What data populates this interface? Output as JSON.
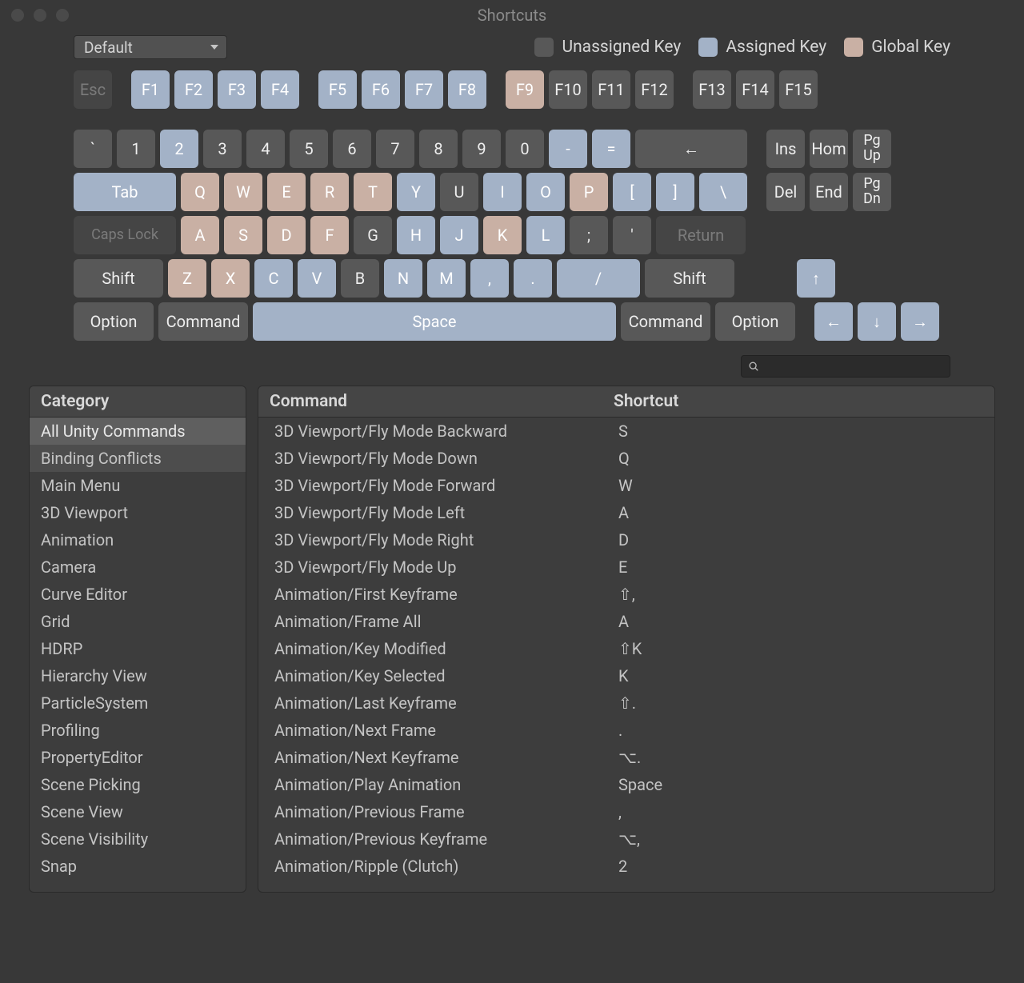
{
  "window": {
    "title": "Shortcuts"
  },
  "toolbar": {
    "profile": "Default",
    "legend": {
      "unassigned": "Unassigned Key",
      "assigned": "Assigned Key",
      "global": "Global Key"
    }
  },
  "keyboard": {
    "row_fn": [
      {
        "label": "Esc",
        "state": "disabled"
      },
      null,
      {
        "label": "F1",
        "state": "assigned"
      },
      {
        "label": "F2",
        "state": "assigned"
      },
      {
        "label": "F3",
        "state": "assigned"
      },
      {
        "label": "F4",
        "state": "assigned"
      },
      null,
      {
        "label": "F5",
        "state": "assigned"
      },
      {
        "label": "F6",
        "state": "assigned"
      },
      {
        "label": "F7",
        "state": "assigned"
      },
      {
        "label": "F8",
        "state": "assigned"
      },
      null,
      {
        "label": "F9",
        "state": "global"
      },
      {
        "label": "F10",
        "state": "unassigned"
      },
      {
        "label": "F11",
        "state": "unassigned"
      },
      {
        "label": "F12",
        "state": "unassigned"
      },
      null,
      {
        "label": "F13",
        "state": "unassigned"
      },
      {
        "label": "F14",
        "state": "unassigned"
      },
      {
        "label": "F15",
        "state": "unassigned"
      }
    ],
    "row_num": {
      "main": [
        {
          "label": "`",
          "state": "unassigned"
        },
        {
          "label": "1",
          "state": "unassigned"
        },
        {
          "label": "2",
          "state": "assigned"
        },
        {
          "label": "3",
          "state": "unassigned"
        },
        {
          "label": "4",
          "state": "unassigned"
        },
        {
          "label": "5",
          "state": "unassigned"
        },
        {
          "label": "6",
          "state": "unassigned"
        },
        {
          "label": "7",
          "state": "unassigned"
        },
        {
          "label": "8",
          "state": "unassigned"
        },
        {
          "label": "9",
          "state": "unassigned"
        },
        {
          "label": "0",
          "state": "unassigned"
        },
        {
          "label": "-",
          "state": "assigned"
        },
        {
          "label": "=",
          "state": "assigned"
        }
      ],
      "backspace": {
        "label": "←",
        "state": "unassigned"
      },
      "right": [
        {
          "label": "Ins",
          "state": "unassigned"
        },
        {
          "label": "Hom",
          "state": "unassigned"
        },
        {
          "label": "Pg\nUp",
          "state": "unassigned"
        }
      ]
    },
    "row_qwerty": {
      "tab": {
        "label": "Tab",
        "state": "assigned"
      },
      "main": [
        {
          "label": "Q",
          "state": "global"
        },
        {
          "label": "W",
          "state": "global"
        },
        {
          "label": "E",
          "state": "global"
        },
        {
          "label": "R",
          "state": "global"
        },
        {
          "label": "T",
          "state": "global"
        },
        {
          "label": "Y",
          "state": "assigned"
        },
        {
          "label": "U",
          "state": "unassigned"
        },
        {
          "label": "I",
          "state": "assigned"
        },
        {
          "label": "O",
          "state": "assigned"
        },
        {
          "label": "P",
          "state": "global"
        },
        {
          "label": "[",
          "state": "assigned"
        },
        {
          "label": "]",
          "state": "assigned"
        },
        {
          "label": "\\",
          "state": "assigned"
        }
      ],
      "right": [
        {
          "label": "Del",
          "state": "unassigned"
        },
        {
          "label": "End",
          "state": "unassigned"
        },
        {
          "label": "Pg\nDn",
          "state": "unassigned"
        }
      ]
    },
    "row_asdf": {
      "caps": {
        "label": "Caps Lock",
        "state": "disabled"
      },
      "main": [
        {
          "label": "A",
          "state": "global"
        },
        {
          "label": "S",
          "state": "global"
        },
        {
          "label": "D",
          "state": "global"
        },
        {
          "label": "F",
          "state": "global"
        },
        {
          "label": "G",
          "state": "unassigned"
        },
        {
          "label": "H",
          "state": "assigned"
        },
        {
          "label": "J",
          "state": "assigned"
        },
        {
          "label": "K",
          "state": "global"
        },
        {
          "label": "L",
          "state": "assigned"
        },
        {
          "label": ";",
          "state": "unassigned"
        },
        {
          "label": "'",
          "state": "unassigned"
        }
      ],
      "return": {
        "label": "Return",
        "state": "disabled"
      }
    },
    "row_zxcv": {
      "shift_l": {
        "label": "Shift",
        "state": "unassigned"
      },
      "main": [
        {
          "label": "Z",
          "state": "global"
        },
        {
          "label": "X",
          "state": "global"
        },
        {
          "label": "C",
          "state": "assigned"
        },
        {
          "label": "V",
          "state": "assigned"
        },
        {
          "label": "B",
          "state": "unassigned"
        },
        {
          "label": "N",
          "state": "assigned"
        },
        {
          "label": "M",
          "state": "assigned"
        },
        {
          "label": ",",
          "state": "assigned"
        },
        {
          "label": ".",
          "state": "assigned"
        },
        {
          "label": "/",
          "state": "assigned"
        }
      ],
      "shift_r": {
        "label": "Shift",
        "state": "unassigned"
      },
      "up": {
        "label": "↑",
        "state": "assigned"
      }
    },
    "row_mod": {
      "option_l": {
        "label": "Option",
        "state": "unassigned"
      },
      "command_l": {
        "label": "Command",
        "state": "unassigned"
      },
      "space": {
        "label": "Space",
        "state": "assigned"
      },
      "command_r": {
        "label": "Command",
        "state": "unassigned"
      },
      "option_r": {
        "label": "Option",
        "state": "unassigned"
      },
      "arrows": [
        {
          "label": "←",
          "state": "assigned"
        },
        {
          "label": "↓",
          "state": "assigned"
        },
        {
          "label": "→",
          "state": "assigned"
        }
      ]
    }
  },
  "categories": {
    "header": "Category",
    "items": [
      "All Unity Commands",
      "Binding Conflicts",
      "Main Menu",
      "3D Viewport",
      "Animation",
      "Camera",
      "Curve Editor",
      "Grid",
      "HDRP",
      "Hierarchy View",
      "ParticleSystem",
      "Profiling",
      "PropertyEditor",
      "Scene Picking",
      "Scene View",
      "Scene Visibility",
      "Snap"
    ],
    "selected_index": 0
  },
  "commands": {
    "header_command": "Command",
    "header_shortcut": "Shortcut",
    "rows": [
      {
        "command": "3D Viewport/Fly Mode Backward",
        "shortcut": "S"
      },
      {
        "command": "3D Viewport/Fly Mode Down",
        "shortcut": "Q"
      },
      {
        "command": "3D Viewport/Fly Mode Forward",
        "shortcut": "W"
      },
      {
        "command": "3D Viewport/Fly Mode Left",
        "shortcut": "A"
      },
      {
        "command": "3D Viewport/Fly Mode Right",
        "shortcut": "D"
      },
      {
        "command": "3D Viewport/Fly Mode Up",
        "shortcut": "E"
      },
      {
        "command": "Animation/First Keyframe",
        "shortcut": "⇧,"
      },
      {
        "command": "Animation/Frame All",
        "shortcut": "A"
      },
      {
        "command": "Animation/Key Modified",
        "shortcut": "⇧K"
      },
      {
        "command": "Animation/Key Selected",
        "shortcut": "K"
      },
      {
        "command": "Animation/Last Keyframe",
        "shortcut": "⇧."
      },
      {
        "command": "Animation/Next Frame",
        "shortcut": "."
      },
      {
        "command": "Animation/Next Keyframe",
        "shortcut": "⌥."
      },
      {
        "command": "Animation/Play Animation",
        "shortcut": "Space"
      },
      {
        "command": "Animation/Previous Frame",
        "shortcut": ","
      },
      {
        "command": "Animation/Previous Keyframe",
        "shortcut": "⌥,"
      },
      {
        "command": "Animation/Ripple (Clutch)",
        "shortcut": "2"
      }
    ]
  }
}
